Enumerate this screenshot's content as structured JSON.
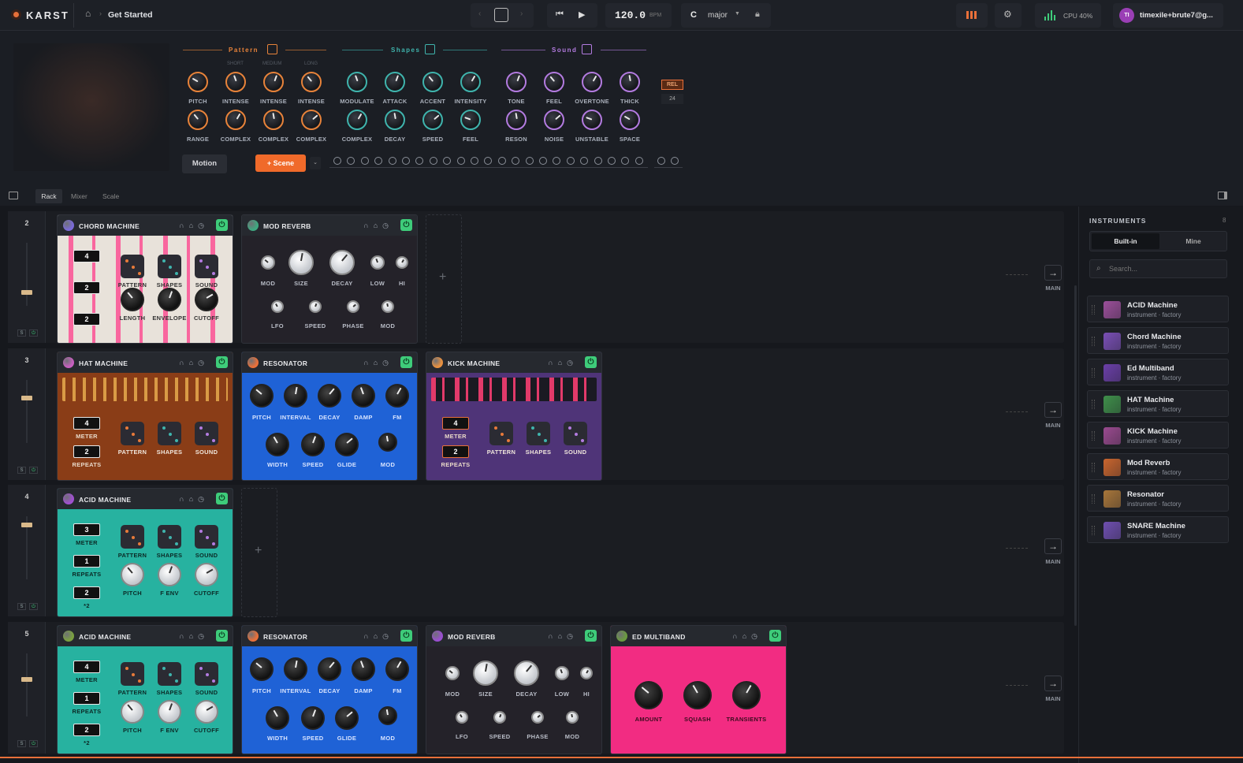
{
  "app": {
    "logo": "KARST",
    "breadcrumb": "Get Started",
    "home_icon": "home-icon"
  },
  "transport": {
    "tempo": "120.0",
    "tempo_unit": "BPM",
    "key": "C",
    "scale": "major",
    "cpu": "CPU 40%",
    "user_initials": "TI",
    "user": "timexile+brute7@g..."
  },
  "macro": {
    "sections": [
      {
        "name": "Pattern",
        "color": "#e8833a"
      },
      {
        "name": "Shapes",
        "color": "#3fb4ad"
      },
      {
        "name": "Sound",
        "color": "#b37be0"
      }
    ],
    "sublabels": [
      "SHORT",
      "MEDIUM",
      "LONG"
    ],
    "pattern_row1": [
      "PITCH",
      "INTENSE",
      "INTENSE",
      "INTENSE"
    ],
    "pattern_row2": [
      "RANGE",
      "COMPLEX",
      "COMPLEX",
      "COMPLEX"
    ],
    "shapes_row1": [
      "MODULATE",
      "ATTACK",
      "ACCENT",
      "INTENSITY"
    ],
    "shapes_row2": [
      "COMPLEX",
      "DECAY",
      "SPEED",
      "FEEL"
    ],
    "sound_row1": [
      "TONE",
      "FEEL",
      "OVERTONE",
      "THICK"
    ],
    "sound_row2": [
      "RESON",
      "NOISE",
      "UNSTABLE",
      "SPACE"
    ],
    "rel_label": "REL",
    "rel_value": "24",
    "motion_button": "Motion",
    "scene_button": "+ Scene"
  },
  "view_tabs": [
    "Rack",
    "Mixer",
    "Scale"
  ],
  "tracks": [
    {
      "num": "2",
      "devices": [
        {
          "title": "CHORD MACHINE",
          "nums": [
            "4",
            "2",
            "2"
          ],
          "dice": [
            "PATTERN",
            "SHAPES",
            "SOUND"
          ],
          "knobs": [
            "LENGTH",
            "ENVELOPE",
            "CUTOFF"
          ]
        },
        {
          "title": "MOD REVERB",
          "row1": [
            "MOD",
            "SIZE",
            "DECAY",
            "LOW",
            "HI"
          ],
          "row2": [
            "LFO",
            "SPEED",
            "PHASE",
            "MOD"
          ]
        }
      ]
    },
    {
      "num": "3",
      "devices": [
        {
          "title": "HAT MACHINE",
          "nums": [
            "4",
            "2"
          ],
          "numlabels": [
            "METER",
            "REPEATS"
          ],
          "dice": [
            "PATTERN",
            "SHAPES",
            "SOUND"
          ]
        },
        {
          "title": "RESONATOR",
          "row1": [
            "PITCH",
            "INTERVAL",
            "DECAY",
            "DAMP",
            "FM"
          ],
          "row2": [
            "WIDTH",
            "SPEED",
            "GLIDE",
            "MOD"
          ]
        },
        {
          "title": "KICK MACHINE",
          "nums": [
            "4",
            "2"
          ],
          "numlabels": [
            "METER",
            "REPEATS"
          ],
          "dice": [
            "PATTERN",
            "SHAPES",
            "SOUND"
          ]
        }
      ]
    },
    {
      "num": "4",
      "devices": [
        {
          "title": "ACID MACHINE",
          "nums": [
            "3",
            "1",
            "2"
          ],
          "numlabels": [
            "METER",
            "REPEATS",
            "*2"
          ],
          "dice": [
            "PATTERN",
            "SHAPES",
            "SOUND"
          ],
          "knobs": [
            "PITCH",
            "F ENV",
            "CUTOFF"
          ]
        }
      ]
    },
    {
      "num": "5",
      "devices": [
        {
          "title": "ACID MACHINE",
          "nums": [
            "4",
            "1",
            "2"
          ],
          "numlabels": [
            "METER",
            "REPEATS",
            "*2"
          ],
          "dice": [
            "PATTERN",
            "SHAPES",
            "SOUND"
          ],
          "knobs": [
            "PITCH",
            "F ENV",
            "CUTOFF"
          ]
        },
        {
          "title": "RESONATOR",
          "row1": [
            "PITCH",
            "INTERVAL",
            "DECAY",
            "DAMP",
            "FM"
          ],
          "row2": [
            "WIDTH",
            "SPEED",
            "GLIDE",
            "MOD"
          ]
        },
        {
          "title": "MOD REVERB",
          "row1": [
            "MOD",
            "SIZE",
            "DECAY",
            "LOW",
            "HI"
          ],
          "row2": [
            "LFO",
            "SPEED",
            "PHASE",
            "MOD"
          ]
        },
        {
          "title": "ED MULTIBAND",
          "knobs": [
            "AMOUNT",
            "SQUASH",
            "TRANSIENTS"
          ]
        }
      ]
    }
  ],
  "route_label": "MAIN",
  "instruments": {
    "title": "INSTRUMENTS",
    "count": "8",
    "tabs": [
      "Built-in",
      "Mine"
    ],
    "search_placeholder": "Search...",
    "items": [
      {
        "name": "ACID Machine",
        "sub": "instrument · factory",
        "color": "#9b4f9a"
      },
      {
        "name": "Chord Machine",
        "sub": "instrument · factory",
        "color": "#7a4fb5"
      },
      {
        "name": "Ed Multiband",
        "sub": "instrument · factory",
        "color": "#6b3fa8"
      },
      {
        "name": "HAT Machine",
        "sub": "instrument · factory",
        "color": "#3f8f4a"
      },
      {
        "name": "KICK Machine",
        "sub": "instrument · factory",
        "color": "#9a4a8f"
      },
      {
        "name": "Mod Reverb",
        "sub": "instrument · factory",
        "color": "#c9652e"
      },
      {
        "name": "Resonator",
        "sub": "instrument · factory",
        "color": "#a8763a"
      },
      {
        "name": "SNARE Machine",
        "sub": "instrument · factory",
        "color": "#6f4fb0"
      }
    ]
  }
}
